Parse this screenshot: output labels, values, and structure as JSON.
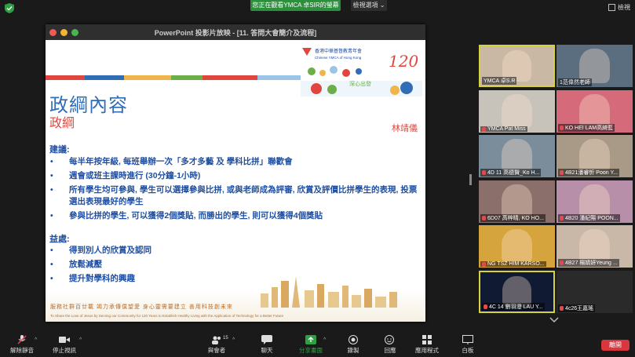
{
  "topbar": {
    "share_banner": "您正在觀看YMCA 卓SIR的螢幕",
    "view_options": "檢視選項",
    "view_options_caret": "⌄",
    "view_button": "檢視"
  },
  "ppt": {
    "window_title": "PowerPoint 投影片放映 - [11. 答問大會簡介及流程]",
    "slide_title": "政綱內容",
    "slide_subtitle": "政綱",
    "author": "林靖儀",
    "logo_org": "香港中華基督教青年會",
    "logo_org_en": "Chinese YMCA of Hong Kong",
    "logo_120": "120",
    "logo_tag": "深心出發",
    "section1_header": "建議:",
    "section1_items": [
      "每半年按年級, 每班舉辦一次「多才多藝 及 學科比拼」聯歡會",
      "週會或班主課時進行 (30分鐘-1小時)",
      "所有學生均可參與, 學生可以選擇參與比拼, 或與老師成為評審, 欣賞及評價比拼學生的表現, 投票選出表現最好的學生",
      "參與比拼的學生, 可以獲得2個獎貼, 而勝出的學生, 則可以獲得4個獎貼"
    ],
    "section2_header": "益處:",
    "section2_items": [
      "得到別人的欣賞及認同",
      "放鬆減壓",
      "提升對學科的興趣"
    ],
    "footer_cn": "服務社群百廿載   竭力承傳僕望愛   身心靈需要建立   善用科技創未來",
    "footer_en": "To Share the Love of Jesus by Serving our Community for 120 Years to Establish Healthy Living with the Application of Technology for a Better Future"
  },
  "participants": [
    {
      "name": "YMCA 卓S.R",
      "bg": "#c9b8a4",
      "active": true,
      "muted": false
    },
    {
      "name": "1范偉然老師",
      "bg": "#5a6e80",
      "active": false,
      "muted": false
    },
    {
      "name": "YMCA Pat Miss",
      "bg": "#c7c2ba",
      "active": false,
      "muted": true
    },
    {
      "name": "KO HEI LAM高綺藍",
      "bg": "#d46a7a",
      "active": false,
      "muted": true
    },
    {
      "name": "4D 11 高德賢_Ko H...",
      "bg": "#7b8c9a",
      "active": false,
      "muted": true
    },
    {
      "name": "4B21潘睿忻 Poon Y...",
      "bg": "#a99a88",
      "active": false,
      "muted": true
    },
    {
      "name": "6D07 高梓晴, KO HO...",
      "bg": "#8a6f6a",
      "active": false,
      "muted": true
    },
    {
      "name": "4B20 潘紀陽 POON...",
      "bg": "#b88fa8",
      "active": false,
      "muted": true
    },
    {
      "name": "NG TSZ HIM KARSO...",
      "bg": "#d6a43c",
      "active": false,
      "muted": true
    },
    {
      "name": "4B27 楊婧妍Yeung ...",
      "bg": "#c9b7a8",
      "active": false,
      "muted": true
    },
    {
      "name": "4C 14 劉羽澄 LAU Y...",
      "bg": "#101a33",
      "active": true,
      "muted": true
    },
    {
      "name": "4c26王嘉瑤",
      "bg": "#2a2a2a",
      "active": false,
      "muted": true
    }
  ],
  "toolbar": {
    "unmute": "解除靜音",
    "stop_video": "停止視訊",
    "participants": "與會者",
    "participants_count": "15",
    "chat": "聊天",
    "share_screen": "分享畫面",
    "record": "錄製",
    "reactions": "回應",
    "apps": "應用程式",
    "whiteboard": "白板",
    "leave": "離開"
  },
  "colors": {
    "accent_green": "#2c8f3c",
    "leave_red": "#d9363e",
    "slide_blue": "#2f6db6",
    "slide_red": "#e0463e",
    "active_border": "#d6d23a"
  }
}
